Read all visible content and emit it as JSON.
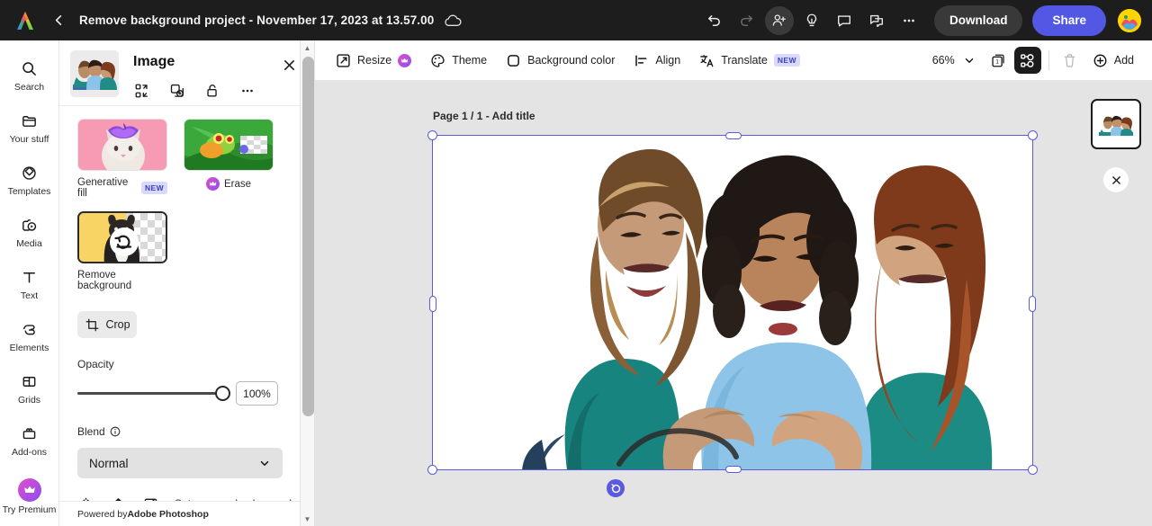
{
  "topbar": {
    "logo_icon": "adobe-express-logo",
    "back_icon": "chevron-left-icon",
    "title": "Remove background project - November 17, 2023 at 13.57.00",
    "cloud_icon": "cloud-saved-icon",
    "undo_icon": "undo-icon",
    "redo_icon": "redo-icon",
    "invite_icon": "invite-user-icon",
    "ideas_icon": "lightbulb-icon",
    "comment_icon": "comment-icon",
    "versions_icon": "duplicate-window-icon",
    "more_icon": "more-horizontal-icon",
    "download_label": "Download",
    "share_label": "Share",
    "avatar_label": "avatar"
  },
  "rail": {
    "items": [
      {
        "icon": "search-icon",
        "label": "Search"
      },
      {
        "icon": "folder-icon",
        "label": "Your stuff"
      },
      {
        "icon": "templates-icon",
        "label": "Templates"
      },
      {
        "icon": "media-icon",
        "label": "Media"
      },
      {
        "icon": "text-icon",
        "label": "Text"
      },
      {
        "icon": "elements-icon",
        "label": "Elements"
      },
      {
        "icon": "grids-icon",
        "label": "Grids"
      },
      {
        "icon": "addons-icon",
        "label": "Add-ons"
      }
    ],
    "premium": {
      "icon": "crown-icon",
      "label": "Try Premium"
    }
  },
  "panel": {
    "title": "Image",
    "thumbnail_name": "selected-image-thumbnail",
    "close_icon": "close-icon",
    "header_icons": [
      {
        "icon": "replace-media-icon",
        "name": "replace-image-button"
      },
      {
        "icon": "duplicate-icon",
        "name": "duplicate-image-button"
      },
      {
        "icon": "unlock-icon",
        "name": "lock-image-button"
      },
      {
        "icon": "more-horizontal-icon",
        "name": "image-more-options-button"
      }
    ],
    "cards": [
      {
        "name": "generative-fill-card",
        "label": "Generative fill",
        "badge": "NEW",
        "premium": false,
        "selected": false
      },
      {
        "name": "erase-card",
        "label": "Erase",
        "badge": "",
        "premium": true,
        "selected": false
      },
      {
        "name": "remove-background-card",
        "label": "Remove background",
        "badge": "",
        "premium": false,
        "selected": true
      }
    ],
    "crop": {
      "label": "Crop",
      "icon": "crop-icon"
    },
    "opacity": {
      "label": "Opacity",
      "value": "100%",
      "percent": 100
    },
    "blend": {
      "label": "Blend",
      "info_icon": "info-icon",
      "value": "Normal",
      "chevron": "chevron-down-icon"
    },
    "bottom_tools": [
      {
        "icon": "flip-horizontal-icon",
        "name": "flip-horizontal-button",
        "label": ""
      },
      {
        "icon": "flip-vertical-icon",
        "name": "flip-vertical-button",
        "label": ""
      },
      {
        "icon": "set-as-page-background-icon",
        "name": "set-as-page-background-button",
        "label": "Set as page background"
      }
    ],
    "powered_prefix": "Powered by ",
    "powered_brand": "Adobe Photoshop",
    "scrollbar": {
      "up_icon": "scroll-up-arrow",
      "down_icon": "scroll-down-arrow"
    }
  },
  "doctoolbar": {
    "items": [
      {
        "name": "resize-button",
        "icon": "resize-icon",
        "label": "Resize",
        "premium": true,
        "badge": ""
      },
      {
        "name": "theme-button",
        "icon": "theme-palette-icon",
        "label": "Theme",
        "premium": false,
        "badge": ""
      },
      {
        "name": "background-color-button",
        "icon": "background-color-icon",
        "label": "Background color",
        "premium": false,
        "badge": ""
      },
      {
        "name": "align-button",
        "icon": "align-icon",
        "label": "Align",
        "premium": false,
        "badge": ""
      },
      {
        "name": "translate-button",
        "icon": "translate-icon",
        "label": "Translate",
        "premium": false,
        "badge": "NEW"
      }
    ],
    "zoom_value": "66%",
    "zoom_chevron": "chevron-down-icon",
    "pages_icon": "page-count-icon",
    "pages_count": "1",
    "layers_icon": "layers-icon",
    "delete_icon": "trash-icon",
    "add_icon": "plus-circle-icon",
    "add_label": "Add"
  },
  "canvas": {
    "page_label": "Page 1 / 1 - Add title",
    "selection": {
      "rotate_icon": "rotate-handle-icon",
      "handles": [
        "top-left",
        "top-center",
        "top-right",
        "middle-left",
        "middle-right",
        "bottom-left",
        "bottom-center",
        "bottom-right"
      ]
    },
    "artwork_alt": "three-women-laughing-photo"
  },
  "pagepanel": {
    "thumbnail_name": "page-1-thumbnail",
    "close_icon": "close-icon"
  },
  "colors": {
    "topbar_bg": "#1d1d1d",
    "accent_share": "#5258e4",
    "selection": "#5a5ae0",
    "canvas_bg": "#e4e4e4",
    "badge_new_bg": "#d8d9ff",
    "badge_new_text": "#3b3fbb"
  }
}
